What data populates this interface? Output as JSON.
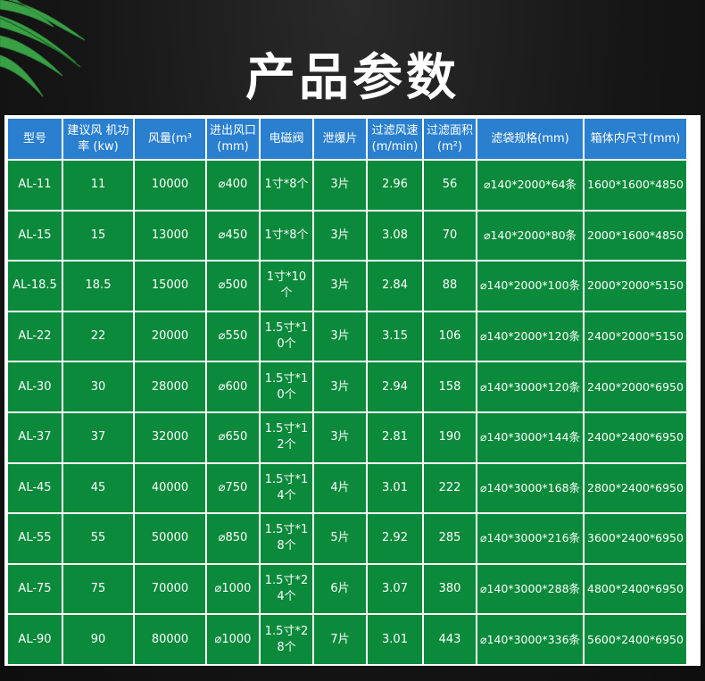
{
  "page": {
    "title": "产品参数"
  },
  "colors": {
    "background": "#141414",
    "header_bg": "#2a7fcf",
    "cell_bg": "#0a8a3a",
    "grid_lines": "#ffffff",
    "text": "#ffffff"
  },
  "decoration": {
    "top_left": "palm-leaf-icon"
  },
  "table": {
    "headers": [
      "型号",
      "建议风 机功率 (kw)",
      "风量(m³",
      "进出风口(mm)",
      "电磁阀",
      "泄爆片",
      "过滤风速(m/min)",
      "过滤面积(m²)",
      "滤袋规格(mm)",
      "箱体内尺寸(mm)"
    ],
    "rows": [
      [
        "AL-11",
        "11",
        "10000",
        "⌀400",
        "1寸*8个",
        "3片",
        "2.96",
        "56",
        "⌀140*2000*64条",
        "1600*1600*4850"
      ],
      [
        "AL-15",
        "15",
        "13000",
        "⌀450",
        "1寸*8个",
        "3片",
        "3.08",
        "70",
        "⌀140*2000*80条",
        "2000*1600*4850"
      ],
      [
        "AL-18.5",
        "18.5",
        "15000",
        "⌀500",
        "1寸*10个",
        "3片",
        "2.84",
        "88",
        "⌀140*2000*100条",
        "2000*2000*5150"
      ],
      [
        "AL-22",
        "22",
        "20000",
        "⌀550",
        "1.5寸*10个",
        "3片",
        "3.15",
        "106",
        "⌀140*2000*120条",
        "2400*2000*5150"
      ],
      [
        "AL-30",
        "30",
        "28000",
        "⌀600",
        "1.5寸*10个",
        "3片",
        "2.94",
        "158",
        "⌀140*3000*120条",
        "2400*2000*6950"
      ],
      [
        "AL-37",
        "37",
        "32000",
        "⌀650",
        "1.5寸*12个",
        "3片",
        "2.81",
        "190",
        "⌀140*3000*144条",
        "2400*2400*6950"
      ],
      [
        "AL-45",
        "45",
        "40000",
        "⌀750",
        "1.5寸*14个",
        "4片",
        "3.01",
        "222",
        "⌀140*3000*168条",
        "2800*2400*6950"
      ],
      [
        "AL-55",
        "55",
        "50000",
        "⌀850",
        "1.5寸*18个",
        "5片",
        "2.92",
        "285",
        "⌀140*3000*216条",
        "3600*2400*6950"
      ],
      [
        "AL-75",
        "75",
        "70000",
        "⌀1000",
        "1.5寸*24个",
        "6片",
        "3.07",
        "380",
        "⌀140*3000*288条",
        "4800*2400*6950"
      ],
      [
        "AL-90",
        "90",
        "80000",
        "⌀1000",
        "1.5寸*28个",
        "7片",
        "3.01",
        "443",
        "⌀140*3000*336条",
        "5600*2400*6950"
      ]
    ]
  }
}
